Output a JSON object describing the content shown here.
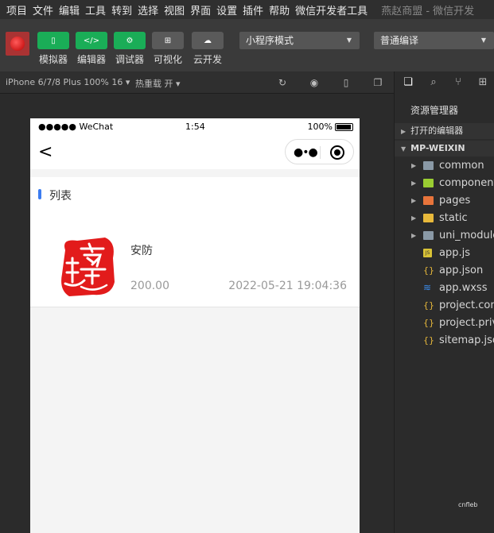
{
  "menu": [
    "项目",
    "文件",
    "编辑",
    "工具",
    "转到",
    "选择",
    "视图",
    "界面",
    "设置",
    "插件",
    "帮助",
    "微信开发者工具"
  ],
  "window_title": "燕赵商盟 - 微信开发",
  "toolbar": {
    "buttons": [
      {
        "label": "模拟器",
        "icon": "phone-icon",
        "glyph": "▯"
      },
      {
        "label": "编辑器",
        "icon": "code-icon",
        "glyph": "</>"
      },
      {
        "label": "调试器",
        "icon": "debug-icon",
        "glyph": "⚙"
      },
      {
        "label": "可视化",
        "icon": "layout-icon",
        "glyph": "⊞"
      },
      {
        "label": "云开发",
        "icon": "cloud-icon",
        "glyph": "☁"
      }
    ],
    "mode_select": "小程序模式",
    "compile_select": "普通编译"
  },
  "devbar": {
    "device": "iPhone 6/7/8 Plus 100% 16 ▾",
    "hot_reload": "热重载 开 ▾"
  },
  "phone": {
    "status": {
      "carrier": "●●●●● WeChat",
      "time": "1:54",
      "battery": "100%"
    },
    "list_title": "列表",
    "item": {
      "name": "安防",
      "price": "200.00",
      "time": "2022-05-21 19:04:36"
    }
  },
  "sidebar": {
    "panel_title": "资源管理器",
    "open_editors": "打开的编辑器",
    "project": "MP-WEIXIN",
    "tree": [
      {
        "label": "common",
        "type": "folder-gray",
        "expandable": true
      },
      {
        "label": "components",
        "type": "folder-green",
        "expandable": true
      },
      {
        "label": "pages",
        "type": "folder-orange",
        "expandable": true
      },
      {
        "label": "static",
        "type": "folder-yellow",
        "expandable": true
      },
      {
        "label": "uni_modules",
        "type": "folder-gray",
        "expandable": true
      },
      {
        "label": "app.js",
        "type": "js",
        "expandable": false
      },
      {
        "label": "app.json",
        "type": "json",
        "expandable": false
      },
      {
        "label": "app.wxss",
        "type": "css",
        "expandable": false
      },
      {
        "label": "project.config.json",
        "type": "json",
        "expandable": false
      },
      {
        "label": "project.private.config.json",
        "type": "json",
        "expandable": false
      },
      {
        "label": "sitemap.json",
        "type": "json",
        "expandable": false
      }
    ]
  },
  "watermark": "cnfleb"
}
